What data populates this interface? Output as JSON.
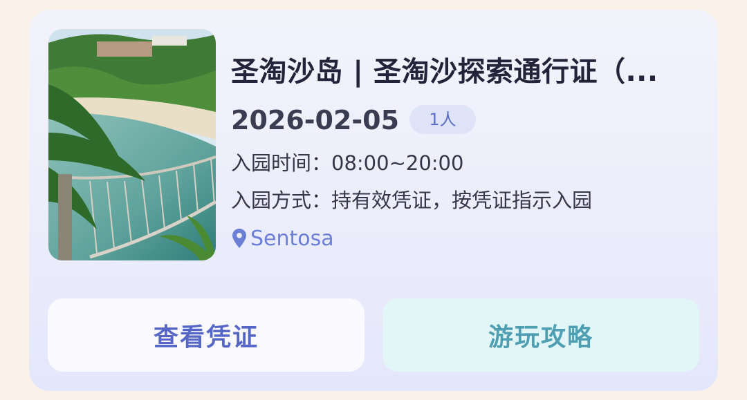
{
  "ticket": {
    "title": "圣淘沙岛 | 圣淘沙探索通行证（...",
    "date": "2026-02-05",
    "people_badge": "1人",
    "entry_time": "入园时间：08:00~20:00",
    "entry_method": "入园方式：持有效凭证，按凭证指示入园",
    "location": "Sentosa",
    "location_icon": "map-pin-icon"
  },
  "actions": {
    "voucher_label": "查看凭证",
    "guide_label": "游玩攻略"
  },
  "colors": {
    "accent": "#5566c6",
    "guide": "#4e9fb2",
    "location": "#6b7fd6"
  }
}
